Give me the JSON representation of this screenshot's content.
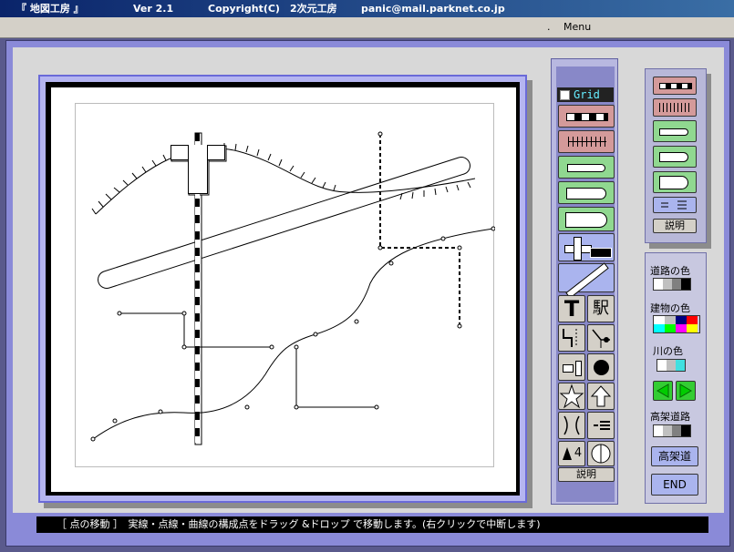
{
  "title": {
    "app_name": "『 地図工房 』",
    "version": "Ver 2.1",
    "copyright": "Copyright(C)　2次元工房",
    "email": "panic@mail.parknet.co.jp"
  },
  "menubar": {
    "dot": ".",
    "menu": "Menu"
  },
  "toolbar": {
    "grid_label": "Grid",
    "explain_label": "説明",
    "station_label": "駅",
    "text_label": "T",
    "number_label": "4"
  },
  "right_panel": {
    "explain_label": "説明",
    "road_color_label": "道路の色",
    "building_color_label": "建物の色",
    "river_color_label": "川の色",
    "elevated_road_label": "高架道路",
    "elevated_button": "高架道",
    "end_button": "END",
    "road_colors": [
      "#ffffff",
      "#c0c0c0",
      "#808080",
      "#000000"
    ],
    "building_colors": [
      "#ffffff",
      "#c0c0c0",
      "#000080",
      "#00ffff",
      "#ff0000",
      "#00ff00",
      "#ff00ff",
      "#ffff00"
    ],
    "river_colors": [
      "#ffffff",
      "#c0c0c0",
      "#40e0e0"
    ],
    "elevated_colors": [
      "#ffffff",
      "#c0c0c0",
      "#808080",
      "#000000"
    ]
  },
  "status": {
    "text": "［ 点の移動 ］　実線・点線・曲線の構成点をドラッグ &ドロップ で移動します。(右クリックで中断します)"
  },
  "colors": {
    "accent": "#8a8ad8",
    "frame": "#b5b5f0",
    "green_button": "#90d890",
    "red_button": "#d49a9a"
  }
}
